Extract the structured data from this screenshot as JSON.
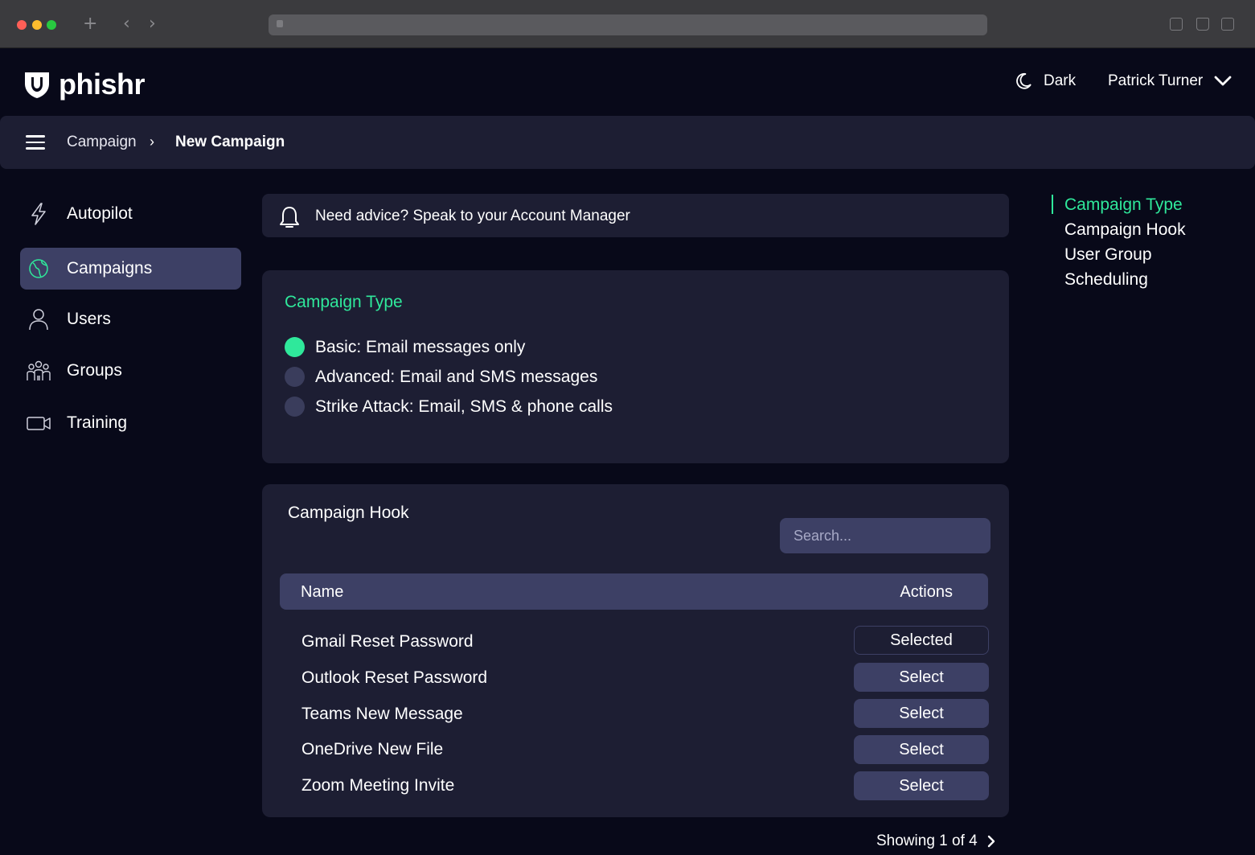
{
  "colors": {
    "accent": "#2fe89b",
    "background": "#080919",
    "panel": "#1d1e33",
    "control": "#3d4065"
  },
  "brand": {
    "name": "phishr",
    "icon": "shield-icon"
  },
  "header": {
    "theme_label": "Dark",
    "theme_icon": "moon-icon",
    "user_name": "Patrick Turner",
    "user_menu_icon": "chevron-down-icon"
  },
  "breadcrumb": {
    "menu_icon": "hamburger-icon",
    "parent": "Campaign",
    "separator": "›",
    "current": "New Campaign"
  },
  "sidebar": {
    "items": [
      {
        "label": "Autopilot",
        "icon": "lightning-icon",
        "active": false
      },
      {
        "label": "Campaigns",
        "icon": "globe-icon",
        "active": true
      },
      {
        "label": "Users",
        "icon": "user-icon",
        "active": false
      },
      {
        "label": "Groups",
        "icon": "group-icon",
        "active": false
      },
      {
        "label": "Training",
        "icon": "video-camera-icon",
        "active": false
      }
    ]
  },
  "advice": {
    "icon": "bell-icon",
    "text": "Need advice? Speak to your Account Manager"
  },
  "campaign_type": {
    "title": "Campaign Type",
    "options": [
      {
        "label": "Basic: Email messages only",
        "selected": true
      },
      {
        "label": "Advanced: Email and SMS messages",
        "selected": false
      },
      {
        "label": "Strike Attack: Email, SMS & phone calls",
        "selected": false
      }
    ]
  },
  "campaign_hook": {
    "title": "Campaign Hook",
    "search_placeholder": "Search...",
    "columns": {
      "name": "Name",
      "actions": "Actions"
    },
    "rows": [
      {
        "name": "Gmail Reset Password",
        "action": "Selected"
      },
      {
        "name": "Outlook Reset Password",
        "action": "Select"
      },
      {
        "name": "Teams New Message",
        "action": "Select"
      },
      {
        "name": "OneDrive New File",
        "action": "Select"
      },
      {
        "name": "Zoom Meeting Invite",
        "action": "Select"
      }
    ],
    "pagination": "Showing 1 of 4",
    "pagination_icon": "chevron-right-icon"
  },
  "toc": {
    "items": [
      {
        "label": "Campaign Type",
        "active": true
      },
      {
        "label": "Campaign Hook",
        "active": false
      },
      {
        "label": "User Group",
        "active": false
      },
      {
        "label": "Scheduling",
        "active": false
      }
    ]
  },
  "browser": {
    "back_icon": "chevron-left-icon",
    "forward_icon": "chevron-right-icon",
    "new_tab_icon": "plus-icon"
  }
}
